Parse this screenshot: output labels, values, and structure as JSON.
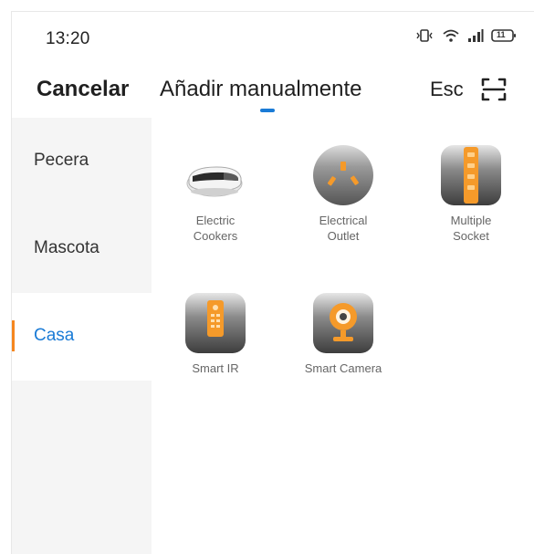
{
  "status_bar": {
    "time": "13:20",
    "battery": "11"
  },
  "header": {
    "cancel": "Cancelar",
    "title": "Añadir manualmente",
    "esc": "Esc"
  },
  "sidebar": {
    "items": [
      {
        "label": "Pecera",
        "active": false
      },
      {
        "label": "Mascota",
        "active": false
      },
      {
        "label": "Casa",
        "active": true
      }
    ]
  },
  "devices": [
    {
      "name": "Electric\nCookers",
      "icon": "electric-cooker-icon"
    },
    {
      "name": "Electrical\nOutlet",
      "icon": "electrical-outlet-icon"
    },
    {
      "name": "Multiple\nSocket",
      "icon": "multiple-socket-icon"
    },
    {
      "name": "Smart IR",
      "icon": "smart-ir-remote-icon"
    },
    {
      "name": "Smart Camera",
      "icon": "smart-camera-icon"
    }
  ],
  "colors": {
    "accent": "#1a7bd6",
    "active_indicator": "#f5861f",
    "sidebar_bg": "#f5f5f5",
    "device_orange": "#f59a2a"
  }
}
